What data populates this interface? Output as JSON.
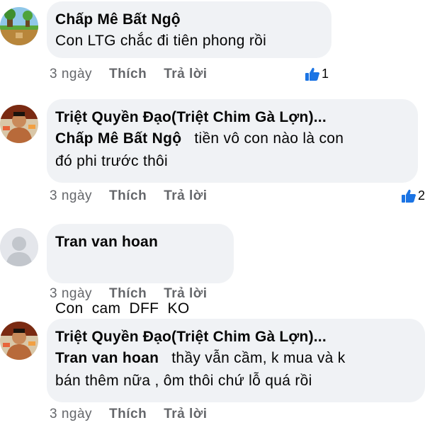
{
  "comments": [
    {
      "author": "Chấp Mê Bất Ngộ",
      "mention": "",
      "text_lines": [
        "Con LTG chắc đi tiên phong rồi"
      ],
      "age": "3 ngày",
      "like_label": "Thích",
      "reply_label": "Trả lời",
      "reaction_count": "1",
      "avatar": "landscape-game-avatar"
    },
    {
      "author": "Triệt Quyền Đạo(Triệt Chim Gà Lợn)...",
      "mention": "Chấp Mê Bất Ngộ",
      "text_lines": [
        "tiền vô con nào là con",
        "đó phi trước thôi"
      ],
      "age": "3 ngày",
      "like_label": "Thích",
      "reply_label": "Trả lời",
      "reaction_count": "2",
      "avatar": "martial-artist-avatar"
    },
    {
      "author": "Tran van hoan",
      "mention": "",
      "text_lines": [
        "Con  cam  DFF  KO"
      ],
      "age": "3 ngày",
      "like_label": "Thích",
      "reply_label": "Trả lời",
      "reaction_count": "",
      "avatar": "default-person-avatar"
    },
    {
      "author": "Triệt Quyền Đạo(Triệt Chim Gà Lợn)...",
      "mention": "Tran van hoan",
      "text_lines": [
        "thầy vẫn cầm, k mua và k",
        "bán thêm nữa , ôm thôi chứ lỗ quá rồi"
      ],
      "age": "3 ngày",
      "like_label": "Thích",
      "reply_label": "Trả lời",
      "reaction_count": "",
      "avatar": "martial-artist-avatar"
    }
  ],
  "colors": {
    "bubble": "#f0f2f5",
    "meta_text": "#65676b",
    "like_blue": "#1b74e4"
  }
}
